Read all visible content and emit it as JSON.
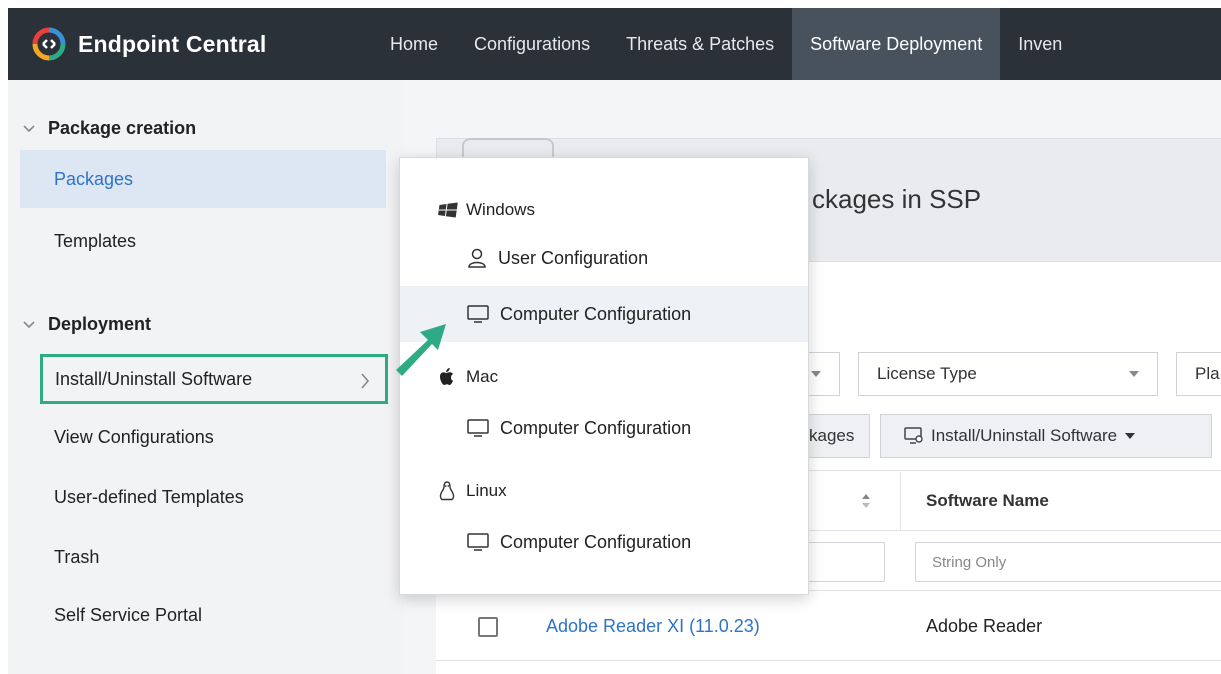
{
  "app": {
    "brand": "Endpoint Central",
    "brand_colors": [
      "#e8413c",
      "#f5a623",
      "#3a8fd9",
      "#2eaa84"
    ]
  },
  "nav": {
    "items": [
      {
        "label": "Home"
      },
      {
        "label": "Configurations"
      },
      {
        "label": "Threats & Patches"
      },
      {
        "label": "Software Deployment"
      },
      {
        "label": "Inven"
      }
    ],
    "active": "Software Deployment"
  },
  "sidebar": {
    "sections": [
      {
        "title": "Package creation",
        "items": [
          "Packages",
          "Templates"
        ]
      },
      {
        "title": "Deployment",
        "items": [
          "Install/Uninstall Software",
          "View Configurations",
          "User-defined Templates",
          "Trash",
          "Self Service Portal"
        ]
      }
    ],
    "active_item": "Packages",
    "highlighted_item": "Install/Uninstall Software",
    "highlight_color": "#2eaa84"
  },
  "panel": {
    "title_partial": "ckages in SSP"
  },
  "toolbar": {
    "license_type": "License Type",
    "platform_partial": "Pla",
    "packages_partial": "kages",
    "install_button": "Install/Uninstall Software"
  },
  "table": {
    "column_software_name": "Software Name",
    "filter_placeholder": "String Only",
    "rows": [
      {
        "package": "Adobe Reader XI (11.0.23)",
        "software": "Adobe Reader"
      }
    ]
  },
  "popup": {
    "windows": {
      "label": "Windows",
      "items": [
        "User Configuration",
        "Computer Configuration"
      ]
    },
    "mac": {
      "label": "Mac",
      "items": [
        "Computer Configuration"
      ]
    },
    "linux": {
      "label": "Linux",
      "items": [
        "Computer Configuration"
      ]
    },
    "active_item": "Computer Configuration"
  },
  "icons": {
    "windows": "windows-icon",
    "apple": "apple-icon",
    "linux": "linux-icon",
    "user": "user-icon",
    "monitor": "monitor-icon"
  },
  "arrow_color": "#2eaa84"
}
